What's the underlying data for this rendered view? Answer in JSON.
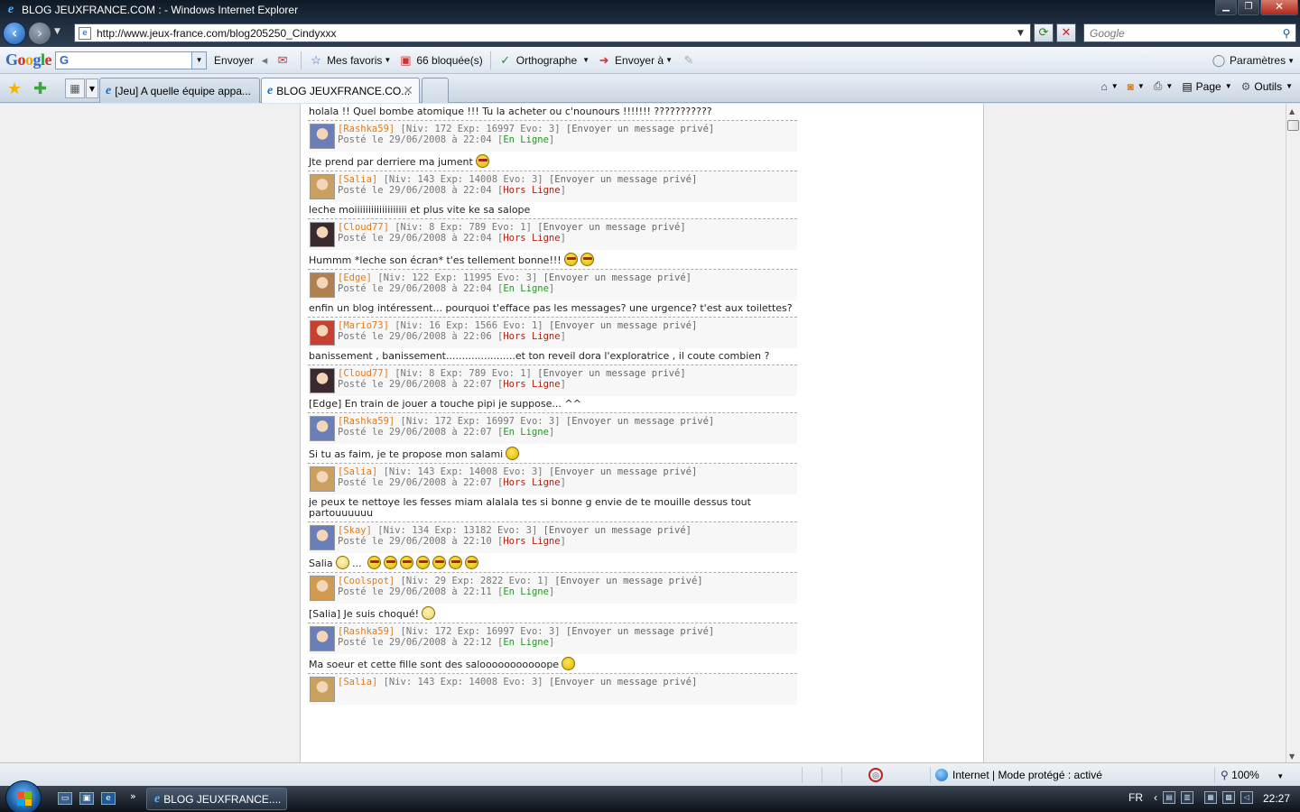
{
  "window": {
    "title": "BLOG JEUXFRANCE.COM : - Windows Internet Explorer"
  },
  "address": {
    "url": "http://www.jeux-france.com/blog205250_Cindyxxx",
    "search_placeholder": "Google"
  },
  "google_toolbar": {
    "logo": "Google",
    "send_label": "Envoyer",
    "favorites_label": "Mes favoris",
    "blocked_label": "66 bloquée(s)",
    "spell_label": "Orthographe",
    "sendto_label": "Envoyer à",
    "settings_label": "Paramètres"
  },
  "tabs": [
    {
      "label": "[Jeu] A quelle équipe appa...",
      "active": false
    },
    {
      "label": "BLOG JEUXFRANCE.CO...",
      "active": true
    }
  ],
  "command_bar": {
    "page_label": "Page",
    "tools_label": "Outils"
  },
  "comments": [
    {
      "text": "holala !! Quel bombe atomique !!! Tu la acheter ou c'nounours !!!!!!! ???????????",
      "smileys": []
    },
    {
      "user": "[Rashka59]",
      "stats": "[Niv: 172 Exp: 16997 Evo: 3]",
      "pm": "[Envoyer un message privé]",
      "posted": "Posté le 29/06/2008 à 22:04",
      "status": "En Ligne",
      "online": true,
      "text": "Jte prend par derriere ma jument",
      "smileys": [
        "cool"
      ]
    },
    {
      "user": "[Salia]",
      "stats": "[Niv: 143 Exp: 14008 Evo: 3]",
      "pm": "[Envoyer un message privé]",
      "posted": "Posté le 29/06/2008 à 22:04",
      "status": "Hors Ligne",
      "online": false,
      "text": "leche moiiiiiiiiiiiiiiiiiii et plus vite ke sa salope",
      "smileys": []
    },
    {
      "user": "[Cloud77]",
      "stats": "[Niv: 8 Exp: 789 Evo: 1]",
      "pm": "[Envoyer un message privé]",
      "posted": "Posté le 29/06/2008 à 22:04",
      "status": "Hors Ligne",
      "online": false,
      "text": "Hummm *leche son écran* t'es tellement bonne!!!",
      "smileys": [
        "cool",
        "cool"
      ]
    },
    {
      "user": "[Edge]",
      "stats": "[Niv: 122 Exp: 11995 Evo: 3]",
      "pm": "[Envoyer un message privé]",
      "posted": "Posté le 29/06/2008 à 22:04",
      "status": "En Ligne",
      "online": true,
      "text": "enfin un blog intéressent... pourquoi t'efface pas les messages? une urgence? t'est aux toilettes?",
      "smileys": []
    },
    {
      "user": "[Mario73]",
      "stats": "[Niv: 16 Exp: 1566 Evo: 1]",
      "pm": "[Envoyer un message privé]",
      "posted": "Posté le 29/06/2008 à 22:06",
      "status": "Hors Ligne",
      "online": false,
      "text": "banissement , banissement......................et ton reveil dora l'exploratrice , il coute combien ?",
      "smileys": []
    },
    {
      "user": "[Cloud77]",
      "stats": "[Niv: 8 Exp: 789 Evo: 1]",
      "pm": "[Envoyer un message privé]",
      "posted": "Posté le 29/06/2008 à 22:07",
      "status": "Hors Ligne",
      "online": false,
      "text": "[Edge] En train de jouer a touche pipi je suppose... ^^",
      "smileys": []
    },
    {
      "user": "[Rashka59]",
      "stats": "[Niv: 172 Exp: 16997 Evo: 3]",
      "pm": "[Envoyer un message privé]",
      "posted": "Posté le 29/06/2008 à 22:07",
      "status": "En Ligne",
      "online": true,
      "text": "Si tu as faim, je te propose mon salami",
      "smileys": [
        "smile"
      ]
    },
    {
      "user": "[Salia]",
      "stats": "[Niv: 143 Exp: 14008 Evo: 3]",
      "pm": "[Envoyer un message privé]",
      "posted": "Posté le 29/06/2008 à 22:07",
      "status": "Hors Ligne",
      "online": false,
      "text": "je peux te nettoye les fesses miam alalala tes si bonne g envie de te mouille dessus tout partouuuuuu",
      "smileys": []
    },
    {
      "user": "[Skay]",
      "stats": "[Niv: 134 Exp: 13182 Evo: 3]",
      "pm": "[Envoyer un message privé]",
      "posted": "Posté le 29/06/2008 à 22:10",
      "status": "Hors Ligne",
      "online": false,
      "text": "Salia",
      "smileys": [
        "shock",
        "...",
        "cool",
        "cool",
        "cool",
        "cool",
        "cool",
        "cool",
        "cool"
      ]
    },
    {
      "user": "[Coolspot]",
      "stats": "[Niv: 29 Exp: 2822 Evo: 1]",
      "pm": "[Envoyer un message privé]",
      "posted": "Posté le 29/06/2008 à 22:11",
      "status": "En Ligne",
      "online": true,
      "text": "[Salia] Je suis choqué!",
      "smileys": [
        "shock"
      ]
    },
    {
      "user": "[Rashka59]",
      "stats": "[Niv: 172 Exp: 16997 Evo: 3]",
      "pm": "[Envoyer un message privé]",
      "posted": "Posté le 29/06/2008 à 22:12",
      "status": "En Ligne",
      "online": true,
      "text": "Ma soeur et cette fille sont des salooooooooooope",
      "smileys": [
        "smile"
      ]
    },
    {
      "user": "[Salia]",
      "stats": "[Niv: 143 Exp: 14008 Evo: 3]",
      "pm": "[Envoyer un message privé]",
      "posted": "",
      "status": "",
      "online": false,
      "text": "",
      "smileys": []
    }
  ],
  "statusbar": {
    "zone": "Internet | Mode protégé : activé",
    "zoom": "100%"
  },
  "taskbar": {
    "task_label": "BLOG JEUXFRANCE....",
    "lang": "FR",
    "time": "22:27"
  }
}
